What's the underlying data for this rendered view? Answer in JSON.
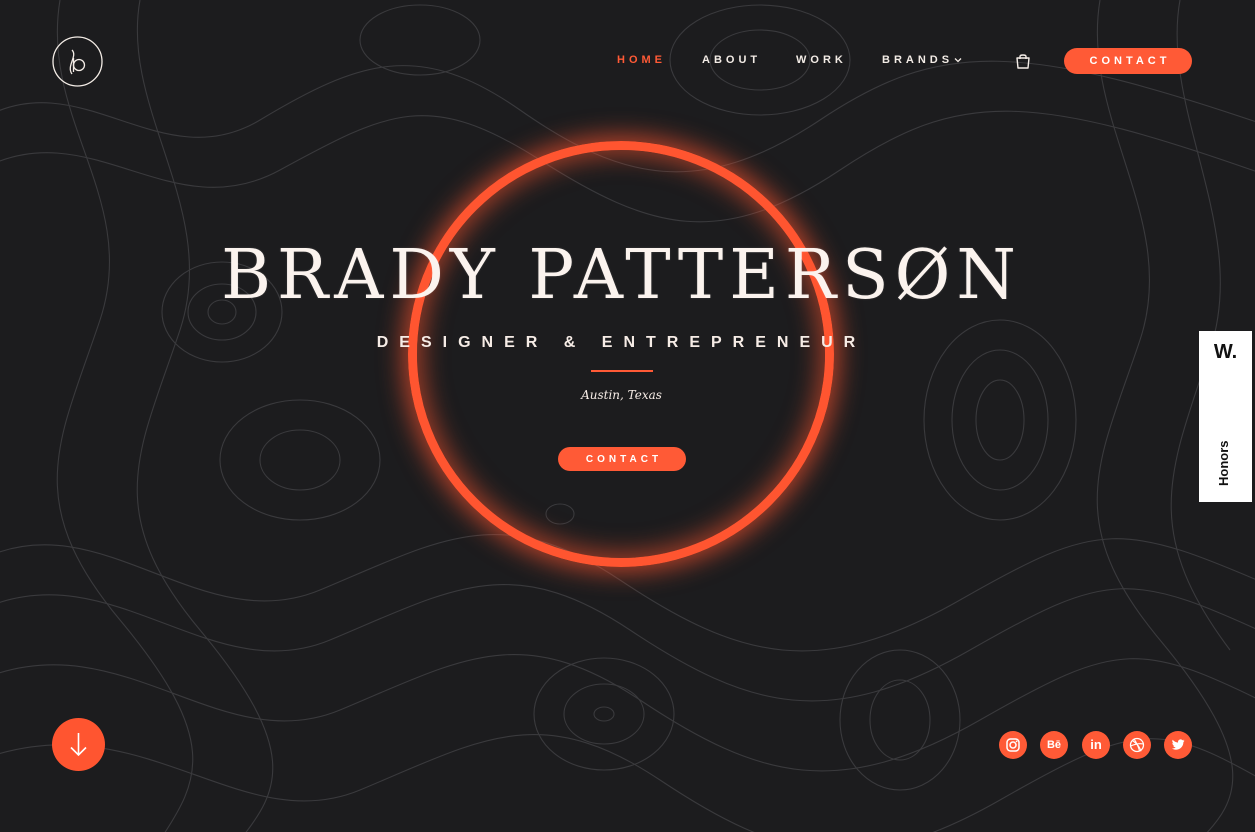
{
  "colors": {
    "accent": "#ff5a36",
    "background": "#1c1c1e",
    "text": "#f3ece6"
  },
  "logo": {
    "icon": "bp-monogram-logo"
  },
  "nav": {
    "items": [
      {
        "label": "HOME",
        "active": true
      },
      {
        "label": "ABOUT",
        "active": false
      },
      {
        "label": "WORK",
        "active": false
      },
      {
        "label": "BRANDS",
        "active": false,
        "has_dropdown": true
      }
    ],
    "cart_icon": "shopping-bag-icon",
    "contact_label": "CONTACT"
  },
  "hero": {
    "name": "BRADY PATTERSØN",
    "subtitle": "DESIGNER & ENTREPRENEUR",
    "location": "Austin, Texas",
    "contact_label": "CONTACT"
  },
  "scroll": {
    "icon": "arrow-down-icon"
  },
  "socials": [
    {
      "name": "instagram",
      "icon": "instagram-icon"
    },
    {
      "name": "behance",
      "icon": "behance-icon",
      "text": "Bē"
    },
    {
      "name": "linkedin",
      "icon": "linkedin-icon",
      "text": "in"
    },
    {
      "name": "dribbble",
      "icon": "dribbble-icon"
    },
    {
      "name": "twitter",
      "icon": "twitter-icon"
    }
  ],
  "honors_badge": {
    "logo": "W.",
    "label": "Honors"
  }
}
